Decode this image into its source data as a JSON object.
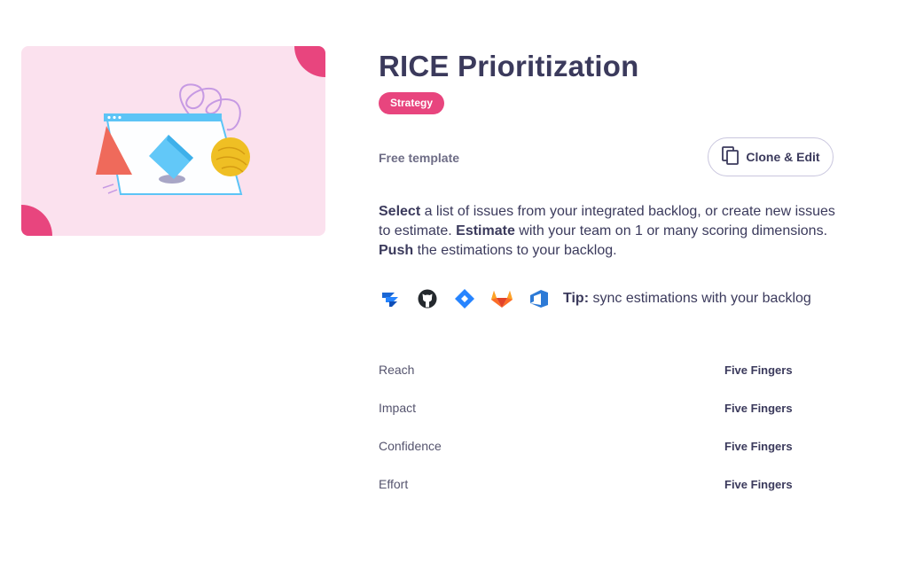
{
  "template": {
    "title": "RICE Prioritization",
    "tag": "Strategy",
    "free_label": "Free template",
    "clone_button": "Clone & Edit"
  },
  "description": {
    "p1_bold": "Select",
    "p1": " a list of issues from your integrated backlog, or create new issues to estimate. ",
    "p2_bold": "Estimate",
    "p2": " with your team on 1 or many scoring dimensions. ",
    "p3_bold": "Push",
    "p3": " the estimations to your backlog."
  },
  "integrations": {
    "icons": [
      "jira-icon",
      "github-icon",
      "jira-software-icon",
      "gitlab-icon",
      "azure-devops-icon"
    ],
    "tip_bold": "Tip:",
    "tip_text": " sync estimations with your backlog"
  },
  "dimensions": [
    {
      "name": "Reach",
      "method": "Five Fingers"
    },
    {
      "name": "Impact",
      "method": "Five Fingers"
    },
    {
      "name": "Confidence",
      "method": "Five Fingers"
    },
    {
      "name": "Effort",
      "method": "Five Fingers"
    }
  ],
  "colors": {
    "accent_pink": "#e8457e",
    "hero_background": "#fbe1ee",
    "text_dark": "#3b3a5c"
  }
}
